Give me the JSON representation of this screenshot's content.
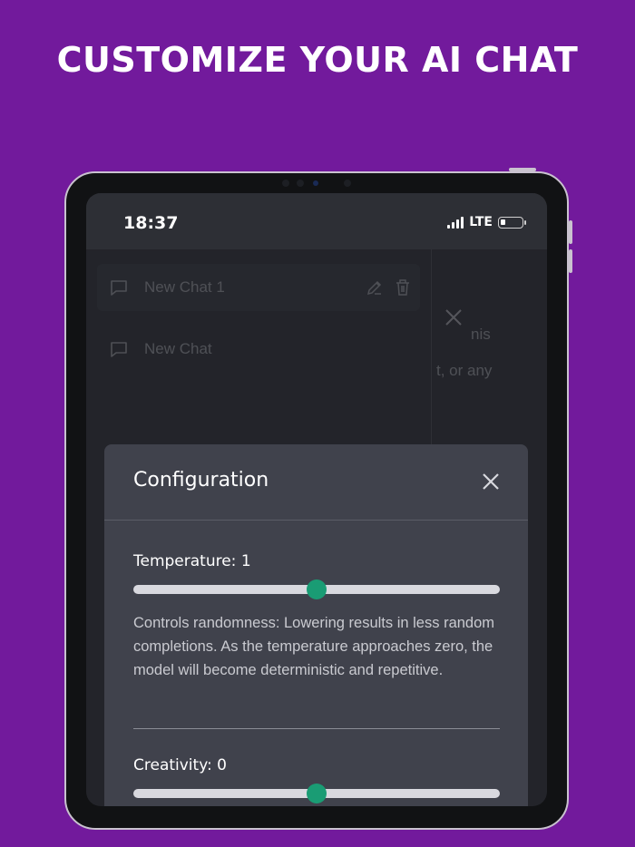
{
  "headline": "CUSTOMIZE YOUR AI CHAT",
  "status_bar": {
    "time": "18:37",
    "network": "LTE"
  },
  "sidebar": {
    "chats": [
      {
        "label": "New Chat 1",
        "active": true
      },
      {
        "label": "New Chat",
        "active": false
      }
    ]
  },
  "background_fragments": [
    "nis",
    "t, or any"
  ],
  "modal": {
    "title": "Configuration",
    "temperature": {
      "label": "Temperature: 1",
      "value_fraction": 0.5,
      "description": "Controls randomness: Lowering results in less random completions. As the temperature approaches zero, the model will become deterministic and repetitive."
    },
    "creativity": {
      "label": "Creativity: 0",
      "value_fraction": 0.5
    }
  },
  "colors": {
    "background": "#721a9c",
    "slider_thumb": "#1a9c74",
    "modal": "#40424c"
  }
}
